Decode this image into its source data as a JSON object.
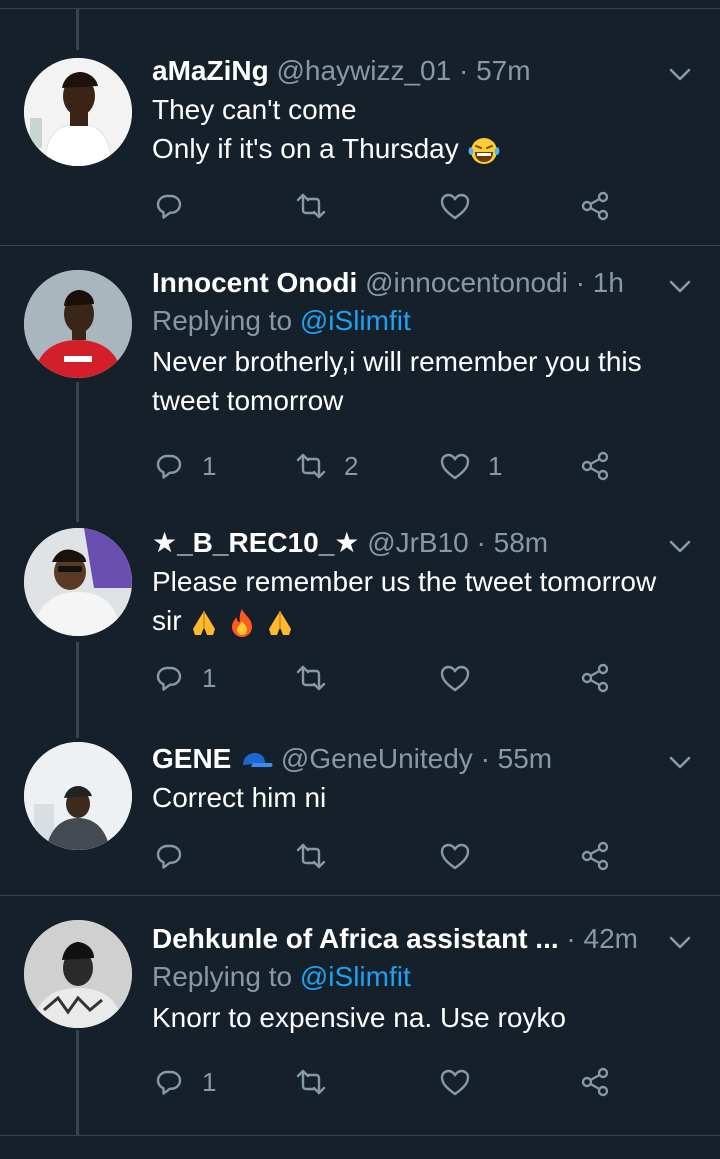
{
  "colors": {
    "background": "#15202b",
    "separator": "#38444d",
    "muted": "#8899a6",
    "link": "#1da1f2"
  },
  "icons": {
    "reply": "reply-icon",
    "retweet": "retweet-icon",
    "like": "heart-icon",
    "share": "share-icon",
    "menu": "chevron-down-icon"
  },
  "tweets": [
    {
      "name": "aMaZiNg",
      "handle": "@haywizz_01",
      "time": "· 57m",
      "replying_label": "",
      "replying_to": "",
      "lines": [
        "They can't come",
        "Only if it's on a Thursday"
      ],
      "emoji": [
        "face-with-tears-of-joy"
      ],
      "reply_count": "",
      "retweet_count": "",
      "like_count": ""
    },
    {
      "name": "Innocent Onodi",
      "handle": "@innocentonodi",
      "time": "· 1h",
      "replying_label": "Replying to ",
      "replying_to": "@iSlimfit",
      "lines": [
        "Never brotherly,i will remember you this",
        "tweet tomorrow"
      ],
      "emoji": [],
      "reply_count": "1",
      "retweet_count": "2",
      "like_count": "1"
    },
    {
      "name": "★_B_REC10_★",
      "handle": "@JrB10",
      "time": "· 58m",
      "replying_label": "",
      "replying_to": "",
      "lines": [
        "Please remember us the tweet tomorrow",
        "sir"
      ],
      "emoji": [
        "folded-hands",
        "fire",
        "folded-hands"
      ],
      "reply_count": "1",
      "retweet_count": "",
      "like_count": ""
    },
    {
      "name": "GENE",
      "handle": "@GeneUnitedy",
      "time": "· 55m",
      "replying_label": "",
      "replying_to": "",
      "lines": [
        "Correct him ni"
      ],
      "emoji": [
        "billed-cap"
      ],
      "reply_count": "",
      "retweet_count": "",
      "like_count": ""
    },
    {
      "name": "Dehkunle of Africa assistant ...",
      "handle": "",
      "time": "· 42m",
      "replying_label": "Replying to ",
      "replying_to": "@iSlimfit",
      "lines": [
        "Knorr to expensive na. Use royko"
      ],
      "emoji": [],
      "reply_count": "1",
      "retweet_count": "",
      "like_count": ""
    }
  ]
}
